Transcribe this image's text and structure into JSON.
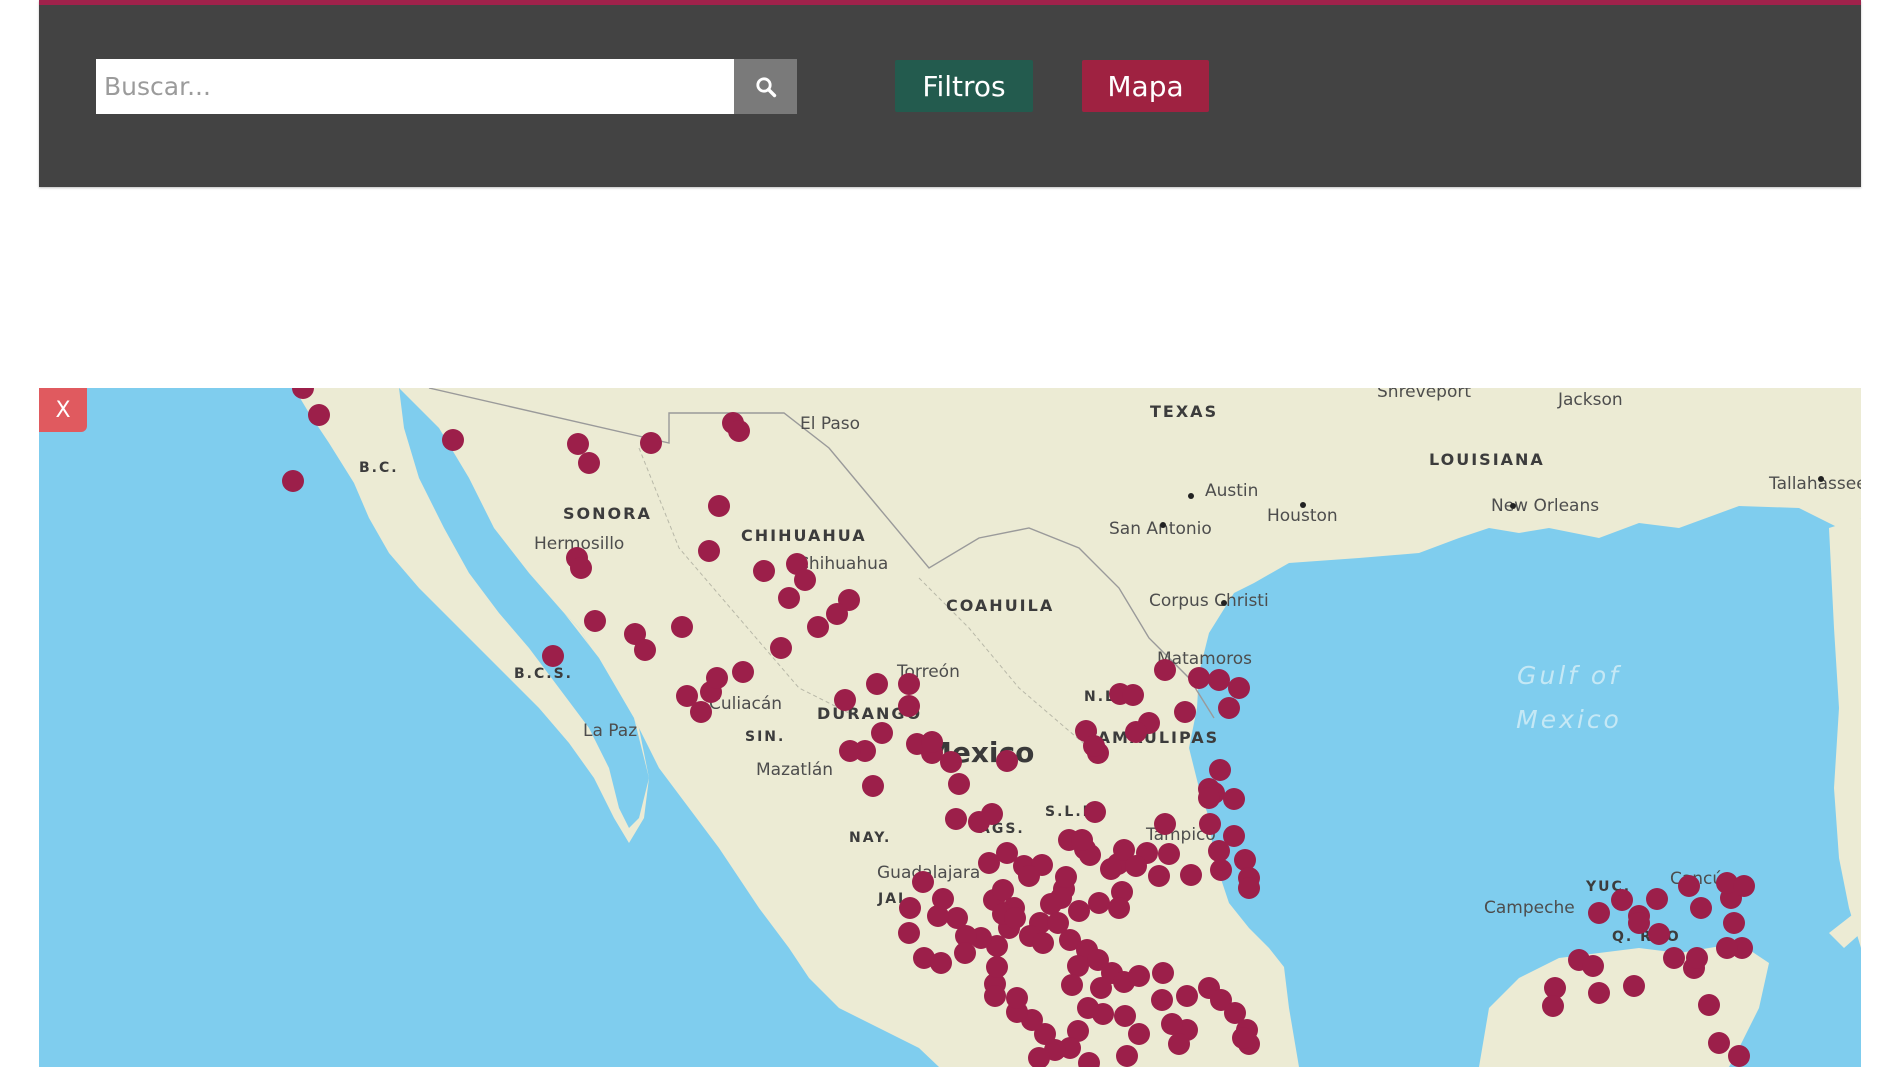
{
  "header": {
    "search_placeholder": "Buscar...",
    "search_icon": "search-icon",
    "filters_label": "Filtros",
    "map_label": "Mapa",
    "accent_color": "#9f2241",
    "filters_color": "#235b4e",
    "bar_color": "#434343"
  },
  "map": {
    "close_label": "X",
    "marker_color": "#9c1f4a",
    "labels": {
      "shreveport": "Shreveport",
      "jackson": "Jackson",
      "texas": "TEXAS",
      "el_paso": "El Paso",
      "louisiana": "LOUISIANA",
      "bc": "B.C.",
      "austin": "Austin",
      "tallahassee": "Tallahassee",
      "houston": "Houston",
      "new_orleans": "New Orleans",
      "sonora": "SONORA",
      "san_antonio": "San Antonio",
      "chihuahua_state": "CHIHUAHUA",
      "hermosillo": "Hermosillo",
      "chihuahua_city": "Chihuahua",
      "coahuila": "COAHUILA",
      "corpus_christi": "Corpus Christi",
      "matamoros": "Matamoros",
      "bcs": "B.C.S.",
      "torreon": "Torreón",
      "gulf_of_mexico": "Gulf of Mexico",
      "culiacan": "Culiacán",
      "durango": "DURANGO",
      "nl": "N.L.",
      "la_paz": "La Paz",
      "sin": "SIN.",
      "tamaulipas": "TAMAULIPAS",
      "mexico": "Mexico",
      "mazatlan": "Mazatlán",
      "slp": "S.L.P.",
      "nay": "NAY.",
      "ags": "AGS.",
      "tampico": "Tampico",
      "guadalajara": "Guadalajara",
      "cancun": "Cancún",
      "yuc": "YUC.",
      "jal": "JAL.",
      "campeche": "Campeche",
      "qroo": "Q. ROO"
    }
  }
}
